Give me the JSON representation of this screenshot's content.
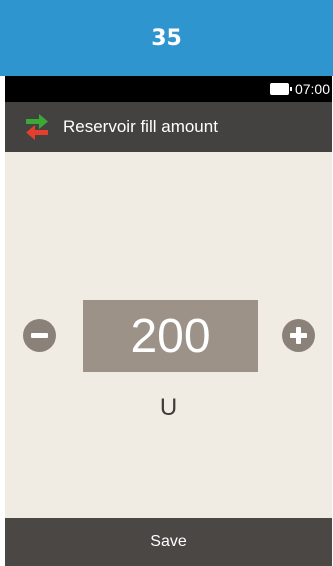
{
  "banner": {
    "step_number": "35"
  },
  "status_bar": {
    "time": "07:00",
    "battery_icon": "battery-icon"
  },
  "title_bar": {
    "icon": "swap-arrows-icon",
    "title": "Reservoir fill amount"
  },
  "fill_amount": {
    "value": "200",
    "unit": "U",
    "decrease_icon": "minus-circle-icon",
    "increase_icon": "plus-circle-icon"
  },
  "footer": {
    "save_label": "Save"
  },
  "colors": {
    "banner": "#2f95cf",
    "title_bar": "#444141",
    "background": "#f1ece3",
    "value_box": "#9c9288",
    "stepper_buttons": "#8a8178",
    "save_bar": "#4a4745",
    "icon_green": "#3aa935",
    "icon_red": "#e2402c"
  }
}
